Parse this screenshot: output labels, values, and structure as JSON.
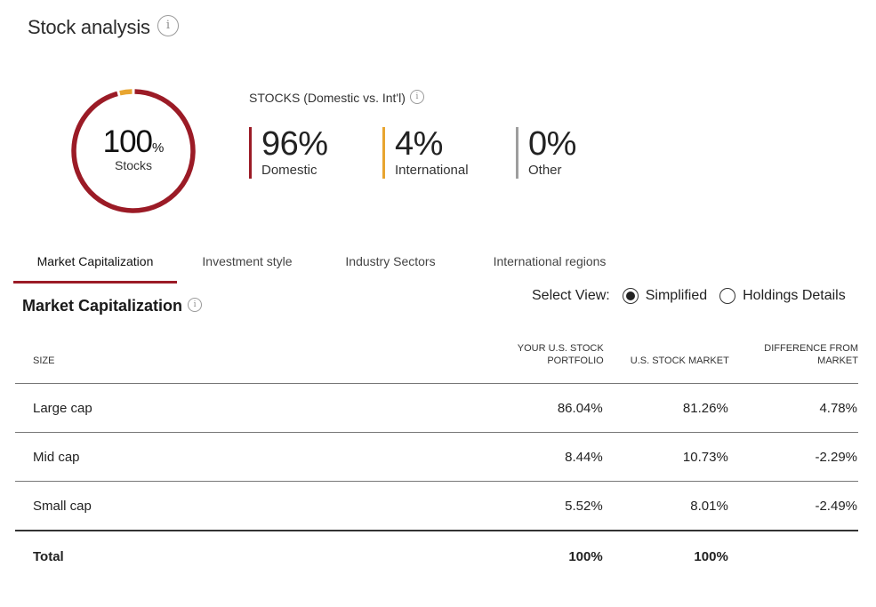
{
  "header": {
    "title": "Stock analysis",
    "info_icon": "info-icon"
  },
  "donut": {
    "value": "100",
    "unit": "%",
    "label": "Stocks",
    "segments": [
      {
        "name": "Domestic",
        "percent": 96,
        "color": "#9b1b26"
      },
      {
        "name": "International",
        "percent": 4,
        "color": "#e8a530"
      },
      {
        "name": "Other",
        "percent": 0,
        "color": "#9e9e9e"
      }
    ]
  },
  "stocks_breakdown": {
    "heading": "STOCKS (Domestic vs. Int'l)",
    "items": [
      {
        "value": "96%",
        "label": "Domestic",
        "color": "#9b1b26"
      },
      {
        "value": "4%",
        "label": "International",
        "color": "#e8a530"
      },
      {
        "value": "0%",
        "label": "Other",
        "color": "#9e9e9e"
      }
    ]
  },
  "tabs": [
    {
      "label": "Market Capitalization",
      "active": true
    },
    {
      "label": "Investment style",
      "active": false
    },
    {
      "label": "Industry Sectors",
      "active": false
    },
    {
      "label": "International regions",
      "active": false
    }
  ],
  "section": {
    "title": "Market Capitalization",
    "select_view_label": "Select View:",
    "view_options": [
      {
        "label": "Simplified",
        "selected": true
      },
      {
        "label": "Holdings Details",
        "selected": false
      }
    ]
  },
  "table": {
    "columns": [
      "SIZE",
      "YOUR U.S. STOCK PORTFOLIO",
      "U.S. STOCK MARKET",
      "DIFFERENCE FROM MARKET"
    ],
    "rows": [
      {
        "size": "Large cap",
        "portfolio": "86.04%",
        "market": "81.26%",
        "difference": "4.78%"
      },
      {
        "size": "Mid cap",
        "portfolio": "8.44%",
        "market": "10.73%",
        "difference": "-2.29%"
      },
      {
        "size": "Small cap",
        "portfolio": "5.52%",
        "market": "8.01%",
        "difference": "-2.49%"
      }
    ],
    "total": {
      "label": "Total",
      "portfolio": "100%",
      "market": "100%",
      "difference": ""
    }
  }
}
